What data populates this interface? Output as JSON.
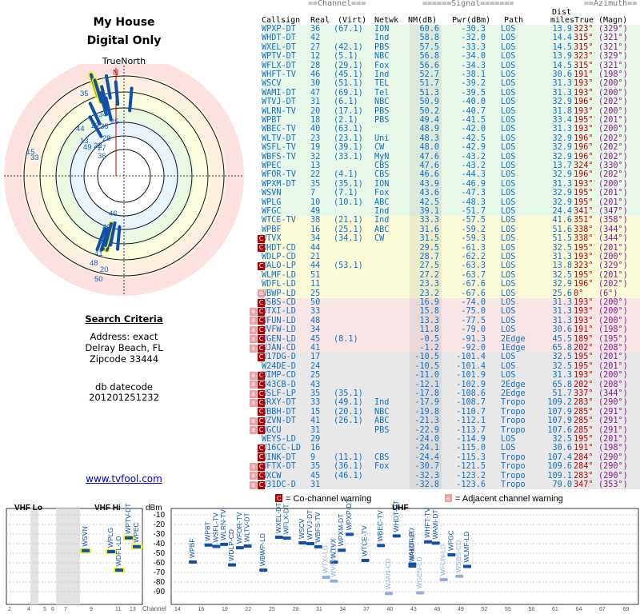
{
  "header": {
    "title_line1": "My House",
    "title_line2": "Digital Only",
    "true_north": "TrueNorth",
    "north_marker": "N"
  },
  "criteria": {
    "heading": "Search Criteria",
    "address": "Address: exact",
    "city": "Delray Beach, FL",
    "zipcode": "Zipcode 33444",
    "datecode_label": "db datecode",
    "datecode": "201201251232"
  },
  "link": "www.tvfool.com",
  "table_header": {
    "group_channel": "==Channel===",
    "group_signal": "======Signal=======",
    "group_azimuth": "==Azimuth==",
    "col_callsign": "Callsign",
    "col_real": "Real",
    "col_virt": "(Virt)",
    "col_netwk": "Netwk",
    "col_nm": "NM(dB)",
    "col_pwr": "Pwr(dBm)",
    "col_path": "Path",
    "col_dist_top": "Dist",
    "col_dist_bot": "miles",
    "col_true": "True",
    "col_magn": "(Magn)"
  },
  "stations": [
    {
      "call": "WPXP-DT",
      "real": "36",
      "virt": "(67.1)",
      "net": "ION",
      "nm": "60.6",
      "pwr": "-30.3",
      "path": "LOS",
      "dist": "13.9",
      "true": "323°",
      "magn": "(329°)",
      "band": "green",
      "warn": ""
    },
    {
      "call": "WHDT-DT",
      "real": "42",
      "virt": "",
      "net": "Ind",
      "nm": "58.8",
      "pwr": "-32.0",
      "path": "LOS",
      "dist": "14.4",
      "true": "315°",
      "magn": "(321°)",
      "band": "green",
      "warn": ""
    },
    {
      "call": "WXEL-DT",
      "real": "27",
      "virt": "(42.1)",
      "net": "PBS",
      "nm": "57.5",
      "pwr": "-33.3",
      "path": "LOS",
      "dist": "14.5",
      "true": "315°",
      "magn": "(321°)",
      "band": "green",
      "warn": ""
    },
    {
      "call": "WPTV-DT",
      "real": "12",
      "virt": "(5.1)",
      "net": "NBC",
      "nm": "56.8",
      "pwr": "-34.0",
      "path": "LOS",
      "dist": "13.9",
      "true": "323°",
      "magn": "(329°)",
      "band": "green",
      "warn": ""
    },
    {
      "call": "WFLX-DT",
      "real": "28",
      "virt": "(29.1)",
      "net": "Fox",
      "nm": "56.6",
      "pwr": "-34.3",
      "path": "LOS",
      "dist": "14.5",
      "true": "315°",
      "magn": "(321°)",
      "band": "green",
      "warn": ""
    },
    {
      "call": "WHFT-TV",
      "real": "46",
      "virt": "(45.1)",
      "net": "Ind",
      "nm": "52.7",
      "pwr": "-38.1",
      "path": "LOS",
      "dist": "30.6",
      "true": "191°",
      "magn": "(198°)",
      "band": "green",
      "warn": ""
    },
    {
      "call": "WSCV",
      "real": "30",
      "virt": "(51.1)",
      "net": "TEL",
      "nm": "51.7",
      "pwr": "-39.2",
      "path": "LOS",
      "dist": "31.3",
      "true": "193°",
      "magn": "(200°)",
      "band": "green",
      "warn": ""
    },
    {
      "call": "WAMI-DT",
      "real": "47",
      "virt": "(69.1)",
      "net": "Tel",
      "nm": "51.3",
      "pwr": "-39.5",
      "path": "LOS",
      "dist": "31.3",
      "true": "193°",
      "magn": "(200°)",
      "band": "green",
      "warn": ""
    },
    {
      "call": "WTVJ-DT",
      "real": "31",
      "virt": "(6.1)",
      "net": "NBC",
      "nm": "50.9",
      "pwr": "-40.0",
      "path": "LOS",
      "dist": "32.9",
      "true": "196°",
      "magn": "(202°)",
      "band": "green",
      "warn": ""
    },
    {
      "call": "WLRN-TV",
      "real": "20",
      "virt": "(17.1)",
      "net": "PBS",
      "nm": "50.2",
      "pwr": "-40.7",
      "path": "LOS",
      "dist": "31.8",
      "true": "193°",
      "magn": "(200°)",
      "band": "green",
      "warn": ""
    },
    {
      "call": "WPBT",
      "real": "18",
      "virt": "(2.1)",
      "net": "PBS",
      "nm": "49.4",
      "pwr": "-41.5",
      "path": "LOS",
      "dist": "33.4",
      "true": "195°",
      "magn": "(201°)",
      "band": "green",
      "warn": ""
    },
    {
      "call": "WBEC-TV",
      "real": "40",
      "virt": "(63.1)",
      "net": "",
      "nm": "48.9",
      "pwr": "-42.0",
      "path": "LOS",
      "dist": "31.3",
      "true": "193°",
      "magn": "(200°)",
      "band": "green",
      "warn": ""
    },
    {
      "call": "WLTV-DT",
      "real": "23",
      "virt": "(23.1)",
      "net": "Uni",
      "nm": "48.3",
      "pwr": "-42.5",
      "path": "LOS",
      "dist": "32.9",
      "true": "196°",
      "magn": "(202°)",
      "band": "green",
      "warn": ""
    },
    {
      "call": "WSFL-TV",
      "real": "19",
      "virt": "(39.1)",
      "net": "CW",
      "nm": "48.0",
      "pwr": "-42.9",
      "path": "LOS",
      "dist": "32.9",
      "true": "196°",
      "magn": "(202°)",
      "band": "green",
      "warn": ""
    },
    {
      "call": "WBFS-TV",
      "real": "32",
      "virt": "(33.1)",
      "net": "MyN",
      "nm": "47.6",
      "pwr": "-43.2",
      "path": "LOS",
      "dist": "32.9",
      "true": "196°",
      "magn": "(202°)",
      "band": "green",
      "warn": ""
    },
    {
      "call": "WPEC",
      "real": "13",
      "virt": "",
      "net": "CBS",
      "nm": "47.6",
      "pwr": "-43.2",
      "path": "LOS",
      "dist": "13.7",
      "true": "324°",
      "magn": "(330°)",
      "band": "green",
      "warn": ""
    },
    {
      "call": "WFOR-TV",
      "real": "22",
      "virt": "(4.1)",
      "net": "CBS",
      "nm": "46.6",
      "pwr": "-44.3",
      "path": "LOS",
      "dist": "32.9",
      "true": "196°",
      "magn": "(202°)",
      "band": "green",
      "warn": ""
    },
    {
      "call": "WPXM-DT",
      "real": "35",
      "virt": "(35.1)",
      "net": "ION",
      "nm": "43.9",
      "pwr": "-46.9",
      "path": "LOS",
      "dist": "31.3",
      "true": "193°",
      "magn": "(200°)",
      "band": "green",
      "warn": ""
    },
    {
      "call": "WSVN",
      "real": "7",
      "virt": "(7.1)",
      "net": "Fox",
      "nm": "43.6",
      "pwr": "-47.3",
      "path": "LOS",
      "dist": "32.9",
      "true": "195°",
      "magn": "(201°)",
      "band": "green",
      "warn": ""
    },
    {
      "call": "WPLG",
      "real": "10",
      "virt": "(10.1)",
      "net": "ABC",
      "nm": "42.5",
      "pwr": "-48.3",
      "path": "LOS",
      "dist": "32.9",
      "true": "195°",
      "magn": "(201°)",
      "band": "green",
      "warn": ""
    },
    {
      "call": "WFGC",
      "real": "49",
      "virt": "",
      "net": "Ind",
      "nm": "39.1",
      "pwr": "-51.7",
      "path": "LOS",
      "dist": "24.4",
      "true": "341°",
      "magn": "(347°)",
      "band": "green",
      "warn": ""
    },
    {
      "call": "WTCE-TV",
      "real": "38",
      "virt": "(21.1)",
      "net": "Ind",
      "nm": "33.3",
      "pwr": "-57.5",
      "path": "LOS",
      "dist": "41.6",
      "true": "351°",
      "magn": "(358°)",
      "band": "yellow",
      "warn": ""
    },
    {
      "call": "WPBF",
      "real": "16",
      "virt": "(25.1)",
      "net": "ABC",
      "nm": "31.6",
      "pwr": "-59.2",
      "path": "LOS",
      "dist": "51.6",
      "true": "338°",
      "magn": "(344°)",
      "band": "yellow",
      "warn": ""
    },
    {
      "call": "WTVX",
      "real": "34",
      "virt": "(34.1)",
      "net": "CW",
      "nm": "31.5",
      "pwr": "-59.3",
      "path": "LOS",
      "dist": "51.5",
      "true": "338°",
      "magn": "(344°)",
      "band": "yellow",
      "warn": "C"
    },
    {
      "call": "WHDT-CD",
      "real": "44",
      "virt": "",
      "net": "",
      "nm": "29.5",
      "pwr": "-61.3",
      "path": "LOS",
      "dist": "32.5",
      "true": "195°",
      "magn": "(201°)",
      "band": "yellow",
      "warn": "C"
    },
    {
      "call": "WDLP-CD",
      "real": "21",
      "virt": "",
      "net": "",
      "nm": "28.7",
      "pwr": "-62.2",
      "path": "LOS",
      "dist": "31.3",
      "true": "193°",
      "magn": "(200°)",
      "band": "yellow",
      "warn": ""
    },
    {
      "call": "WALO-LP",
      "real": "44",
      "virt": "(53.1)",
      "net": "",
      "nm": "27.5",
      "pwr": "-63.3",
      "path": "LOS",
      "dist": "13.8",
      "true": "323°",
      "magn": "(329°)",
      "band": "yellow",
      "warn": "C"
    },
    {
      "call": "WLMF-LD",
      "real": "51",
      "virt": "",
      "net": "",
      "nm": "27.2",
      "pwr": "-63.7",
      "path": "LOS",
      "dist": "32.5",
      "true": "195°",
      "magn": "(201°)",
      "band": "yellow",
      "warn": ""
    },
    {
      "call": "WDFL-LD",
      "real": "11",
      "virt": "",
      "net": "",
      "nm": "23.3",
      "pwr": "-67.6",
      "path": "LOS",
      "dist": "32.9",
      "true": "196°",
      "magn": "(202°)",
      "band": "yellow",
      "warn": ""
    },
    {
      "call": "WBWP-LD",
      "real": "25",
      "virt": "",
      "net": "",
      "nm": "23.2",
      "pwr": "-67.6",
      "path": "LOS",
      "dist": "25.6",
      "true": "0°",
      "magn": "(6°)",
      "band": "yellow",
      "warn": "a"
    },
    {
      "call": "WSBS-CD",
      "real": "50",
      "virt": "",
      "net": "",
      "nm": "16.9",
      "pwr": "-74.0",
      "path": "LOS",
      "dist": "31.3",
      "true": "193°",
      "magn": "(200°)",
      "band": "pink",
      "warn": "C"
    },
    {
      "call": "WTXI-LD",
      "real": "33",
      "virt": "",
      "net": "",
      "nm": "15.8",
      "pwr": "-75.0",
      "path": "LOS",
      "dist": "31.3",
      "true": "193°",
      "magn": "(200°)",
      "band": "pink",
      "warn": "aC"
    },
    {
      "call": "WFUN-LD",
      "real": "48",
      "virt": "",
      "net": "",
      "nm": "13.3",
      "pwr": "-77.5",
      "path": "LOS",
      "dist": "31.3",
      "true": "193°",
      "magn": "(200°)",
      "band": "pink",
      "warn": "aC"
    },
    {
      "call": "WVFW-LD",
      "real": "34",
      "virt": "",
      "net": "",
      "nm": "11.8",
      "pwr": "-79.0",
      "path": "LOS",
      "dist": "30.6",
      "true": "191°",
      "magn": "(198°)",
      "band": "pink",
      "warn": "aC"
    },
    {
      "call": "WGEN-LD",
      "real": "45",
      "virt": "(8.1)",
      "net": "",
      "nm": "-0.5",
      "pwr": "-91.3",
      "path": "2Edge",
      "dist": "45.5",
      "true": "189°",
      "magn": "(195°)",
      "band": "pink",
      "warn": "aC"
    },
    {
      "call": "WJAN-CD",
      "real": "41",
      "virt": "",
      "net": "",
      "nm": "-1.2",
      "pwr": "-92.0",
      "path": "1Edge",
      "dist": "65.8",
      "true": "202°",
      "magn": "(208°)",
      "band": "pink",
      "warn": "aC"
    },
    {
      "call": "W17DG-D",
      "real": "17",
      "virt": "",
      "net": "",
      "nm": "-10.5",
      "pwr": "-101.4",
      "path": "LOS",
      "dist": "32.5",
      "true": "195°",
      "magn": "(201°)",
      "band": "gray",
      "warn": "C"
    },
    {
      "call": "W24DE-D",
      "real": "24",
      "virt": "",
      "net": "",
      "nm": "-10.5",
      "pwr": "-101.4",
      "path": "LOS",
      "dist": "32.5",
      "true": "195°",
      "magn": "(201°)",
      "band": "gray",
      "warn": ""
    },
    {
      "call": "WIMP-CD",
      "real": "25",
      "virt": "",
      "net": "",
      "nm": "-11.0",
      "pwr": "-101.9",
      "path": "LOS",
      "dist": "31.3",
      "true": "193°",
      "magn": "(200°)",
      "band": "gray",
      "warn": "aC"
    },
    {
      "call": "W43CB-D",
      "real": "43",
      "virt": "",
      "net": "",
      "nm": "-12.1",
      "pwr": "-102.9",
      "path": "2Edge",
      "dist": "65.8",
      "true": "202°",
      "magn": "(208°)",
      "band": "gray",
      "warn": "aC"
    },
    {
      "call": "WSLF-LP",
      "real": "35",
      "virt": "(35.1)",
      "net": "",
      "nm": "-17.8",
      "pwr": "-108.6",
      "path": "2Edge",
      "dist": "51.7",
      "true": "337°",
      "magn": "(344°)",
      "band": "gray",
      "warn": "aC"
    },
    {
      "call": "WRXY-DT",
      "real": "33",
      "virt": "(49.1)",
      "net": "Ind",
      "nm": "-17.9",
      "pwr": "-108.7",
      "path": "Tropo",
      "dist": "109.2",
      "true": "283°",
      "magn": "(290°)",
      "band": "gray",
      "warn": "aC"
    },
    {
      "call": "WBBH-DT",
      "real": "15",
      "virt": "(20.1)",
      "net": "NBC",
      "nm": "-19.8",
      "pwr": "-110.7",
      "path": "Tropo",
      "dist": "107.9",
      "true": "285°",
      "magn": "(291°)",
      "band": "gray",
      "warn": "C"
    },
    {
      "call": "WZVN-DT",
      "real": "41",
      "virt": "(26.1)",
      "net": "ABC",
      "nm": "-21.3",
      "pwr": "-112.1",
      "path": "Tropo",
      "dist": "107.9",
      "true": "285°",
      "magn": "(291°)",
      "band": "gray",
      "warn": "aC"
    },
    {
      "call": "WGCU",
      "real": "31",
      "virt": "",
      "net": "PBS",
      "nm": "-22.9",
      "pwr": "-113.7",
      "path": "Tropo",
      "dist": "107.6",
      "true": "285°",
      "magn": "(291°)",
      "band": "gray",
      "warn": "aC"
    },
    {
      "call": "WEYS-LD",
      "real": "29",
      "virt": "",
      "net": "",
      "nm": "-24.0",
      "pwr": "-114.9",
      "path": "LOS",
      "dist": "32.5",
      "true": "195°",
      "magn": "(201°)",
      "band": "gray",
      "warn": ""
    },
    {
      "call": "W16CC-LD",
      "real": "16",
      "virt": "",
      "net": "",
      "nm": "-24.1",
      "pwr": "-115.0",
      "path": "LOS",
      "dist": "30.6",
      "true": "191°",
      "magn": "(198°)",
      "band": "gray",
      "warn": "C"
    },
    {
      "call": "WINK-DT",
      "real": "9",
      "virt": "(11.1)",
      "net": "CBS",
      "nm": "-24.4",
      "pwr": "-115.3",
      "path": "Tropo",
      "dist": "107.4",
      "true": "284°",
      "magn": "(290°)",
      "band": "gray",
      "warn": "C"
    },
    {
      "call": "WFTX-DT",
      "real": "35",
      "virt": "(36.1)",
      "net": "Fox",
      "nm": "-30.7",
      "pwr": "-121.5",
      "path": "Tropo",
      "dist": "109.6",
      "true": "284°",
      "magn": "(290°)",
      "band": "gray",
      "warn": "aC"
    },
    {
      "call": "WXCW",
      "real": "45",
      "virt": "(46.1)",
      "net": "",
      "nm": "-32.3",
      "pwr": "-123.2",
      "path": "Tropo",
      "dist": "109.1",
      "true": "283°",
      "magn": "(290°)",
      "band": "gray",
      "warn": "aC"
    },
    {
      "call": "W31DC-D",
      "real": "31",
      "virt": "",
      "net": "",
      "nm": "-32.8",
      "pwr": "-123.6",
      "path": "Tropo",
      "dist": "79.0",
      "true": "347°",
      "magn": "(353°)",
      "band": "gray",
      "warn": "aC"
    }
  ],
  "legend": {
    "cochannel": "= Co-channel warning",
    "adjacent": "= Adjacent channel warning",
    "c_mark": "C",
    "a_mark": "a"
  },
  "bottom": {
    "vhf_lo": "VHF Lo",
    "vhf_hi": "VHF Hi",
    "uhf": "UHF",
    "dbm": "dBm",
    "channel": "Channel",
    "dbm_ticks": [
      "-10",
      "-20",
      "-30",
      "-40",
      "-50",
      "-60",
      "-70",
      "-80",
      "-90"
    ],
    "vhf_ticks": [
      "2",
      "4",
      "5",
      "6",
      "7",
      "9",
      "11",
      "13"
    ],
    "uhf_ticks": [
      "14",
      "16",
      "19",
      "22",
      "25",
      "28",
      "31",
      "34",
      "37",
      "40",
      "43",
      "46",
      "49",
      "52",
      "55",
      "58",
      "61",
      "64",
      "67",
      "69"
    ]
  },
  "polar_labels": [
    "35",
    "34",
    "44",
    "19",
    "38",
    "25",
    "28",
    "13",
    "49",
    "22",
    "27",
    "36",
    "15",
    "33",
    "46",
    "40",
    "41",
    "48",
    "50",
    "20"
  ],
  "colors": {
    "green": "#e8f8e8",
    "yellow": "#fbfbd8",
    "pink": "#f8e6e6",
    "gray": "#e8e8e8",
    "callsign": "#1070c8",
    "azimuth_true": "#c00000",
    "azimuth_magn": "#8a1a8a",
    "warn_c": "#b00000",
    "warn_a": "#f0a0a0"
  }
}
